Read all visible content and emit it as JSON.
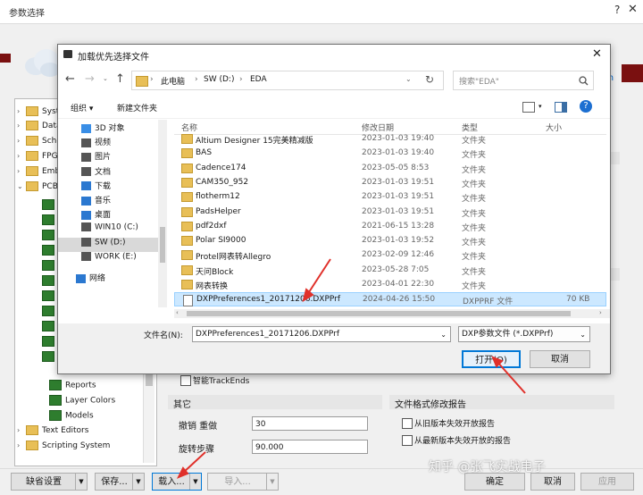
{
  "bg_window": {
    "title": "参数选择",
    "help": "?",
    "close": "✕",
    "tree_items": [
      {
        "label": "Syste",
        "type": "folder",
        "expand": "›"
      },
      {
        "label": "Data",
        "type": "folder",
        "expand": "›"
      },
      {
        "label": "Sche",
        "type": "folder",
        "expand": "›"
      },
      {
        "label": "FPG",
        "type": "folder",
        "expand": "›"
      },
      {
        "label": "Emb",
        "type": "folder",
        "expand": "›"
      },
      {
        "label": "PCB",
        "type": "folder",
        "expand": "⌄"
      },
      {
        "label": "Reports",
        "type": "pcb",
        "expand": ""
      },
      {
        "label": "Layer Colors",
        "type": "pcb",
        "expand": ""
      },
      {
        "label": "Models",
        "type": "pcb",
        "expand": ""
      },
      {
        "label": "Text Editors",
        "type": "folder",
        "expand": "›"
      },
      {
        "label": "Scripting System",
        "type": "folder",
        "expand": "›"
      }
    ],
    "partial_link": "in",
    "trackends_label": "智能TrackEnds",
    "other_group": "其它",
    "undo_label": "撤销 重做",
    "undo_value": "30",
    "rotate_label": "旋转步骤",
    "rotate_value": "90.000",
    "format_group": "文件格式修改报告",
    "format_opt1": "从旧版本失效开放报告",
    "format_opt2": "从最新版本失效开放的报告",
    "buttons": {
      "defaults": "缺省设置",
      "save": "保存...",
      "load": "载入...",
      "import": "导入...",
      "ok": "确定",
      "cancel": "取消",
      "apply": "应用"
    },
    "watermark": "知乎 @张飞实战电子"
  },
  "dialog": {
    "title": "加载优先选择文件",
    "close": "✕",
    "breadcrumb": [
      "此电脑",
      "SW (D:)",
      "EDA"
    ],
    "search_placeholder": "搜索\"EDA\"",
    "organize": "组织 ▾",
    "new_folder": "新建文件夹",
    "nav_items": [
      {
        "label": "3D 对象",
        "icon": "cube-icon",
        "color": "#3a8ee6"
      },
      {
        "label": "视频",
        "icon": "video-icon",
        "color": "#555"
      },
      {
        "label": "图片",
        "icon": "picture-icon",
        "color": "#555"
      },
      {
        "label": "文档",
        "icon": "document-icon",
        "color": "#555"
      },
      {
        "label": "下载",
        "icon": "download-icon",
        "color": "#2b78d0"
      },
      {
        "label": "音乐",
        "icon": "music-icon",
        "color": "#2b78d0"
      },
      {
        "label": "桌面",
        "icon": "desktop-icon",
        "color": "#2b78d0"
      },
      {
        "label": "WIN10 (C:)",
        "icon": "drive-icon",
        "color": "#555"
      },
      {
        "label": "SW (D:)",
        "icon": "drive-icon",
        "color": "#555"
      },
      {
        "label": "WORK (E:)",
        "icon": "drive-icon",
        "color": "#555"
      },
      {
        "label": "网络",
        "icon": "network-icon",
        "color": "#2b78d0"
      }
    ],
    "columns": {
      "name": "名称",
      "date": "修改日期",
      "type": "类型",
      "size": "大小"
    },
    "files": [
      {
        "name": "Altium Designer 15完美精减版",
        "date": "2023-01-03 19:40",
        "type": "文件夹",
        "size": ""
      },
      {
        "name": "BAS",
        "date": "2023-01-03 19:40",
        "type": "文件夹",
        "size": ""
      },
      {
        "name": "Cadence174",
        "date": "2023-05-05 8:53",
        "type": "文件夹",
        "size": ""
      },
      {
        "name": "CAM350_952",
        "date": "2023-01-03 19:51",
        "type": "文件夹",
        "size": ""
      },
      {
        "name": "flotherm12",
        "date": "2023-01-03 19:51",
        "type": "文件夹",
        "size": ""
      },
      {
        "name": "PadsHelper",
        "date": "2023-01-03 19:51",
        "type": "文件夹",
        "size": ""
      },
      {
        "name": "pdf2dxf",
        "date": "2021-06-15 13:28",
        "type": "文件夹",
        "size": ""
      },
      {
        "name": "Polar SI9000",
        "date": "2023-01-03 19:52",
        "type": "文件夹",
        "size": ""
      },
      {
        "name": "Protel网表转Allegro",
        "date": "2023-02-09 12:46",
        "type": "文件夹",
        "size": ""
      },
      {
        "name": "天问Block",
        "date": "2023-05-28 7:05",
        "type": "文件夹",
        "size": ""
      },
      {
        "name": "网表转换",
        "date": "2023-04-01 22:30",
        "type": "文件夹",
        "size": ""
      },
      {
        "name": "DXPPreferences1_20171206.DXPPrf",
        "date": "2024-04-26 15:50",
        "type": "DXPPRF 文件",
        "size": "70 KB"
      }
    ],
    "filename_label": "文件名(N):",
    "filename_value": "DXPPreferences1_20171206.DXPPrf",
    "filter_value": "DXP参数文件 (*.DXPPrf)",
    "open_button": "打开(O)",
    "cancel_button": "取消"
  },
  "colors": {
    "selection": "#cce8ff",
    "annotation_arrow": "#e0302a",
    "accent": "#0078d7"
  }
}
